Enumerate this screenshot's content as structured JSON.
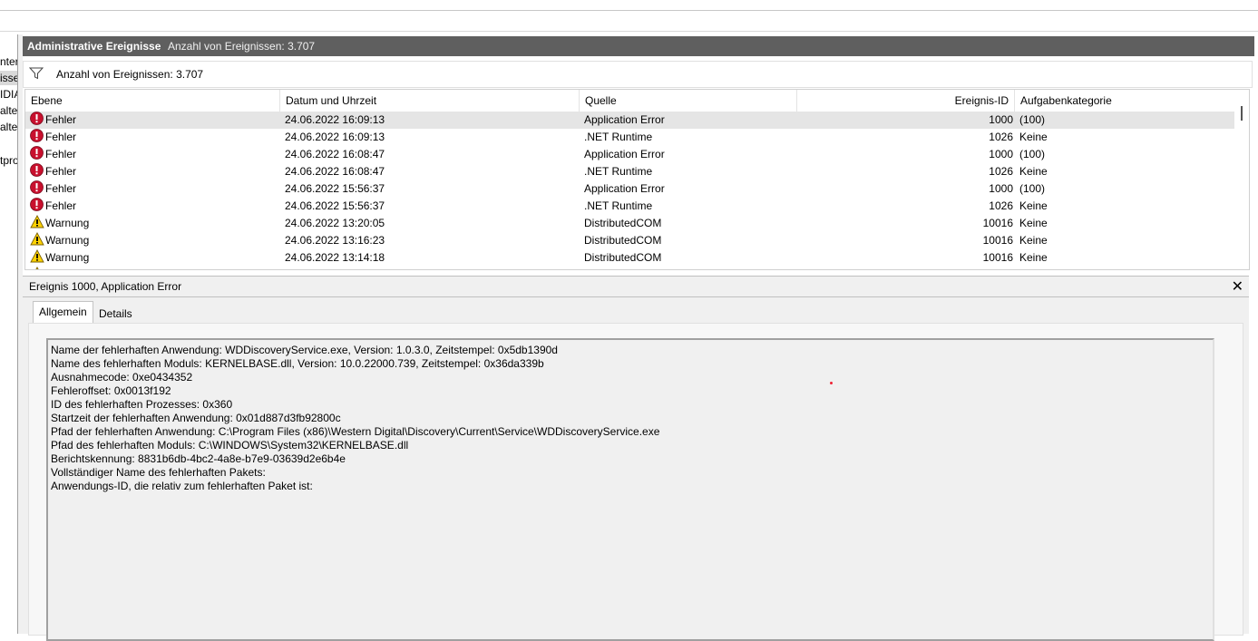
{
  "left_pane": {
    "items": [
      "nter",
      "isse",
      "IDIA",
      "altel",
      "altel",
      "tpro"
    ]
  },
  "header": {
    "title": "Administrative Ereignisse",
    "count": "Anzahl von Ereignissen: 3.707"
  },
  "filter": {
    "text": "Anzahl von Ereignissen: 3.707",
    "icon": "filter-icon"
  },
  "columns": {
    "level": "Ebene",
    "datetime": "Datum und Uhrzeit",
    "source": "Quelle",
    "event_id": "Ereignis-ID",
    "task_category": "Aufgabenkategorie"
  },
  "events": [
    {
      "level": "Fehler",
      "icon": "error-icon",
      "datetime": "24.06.2022 16:09:13",
      "source": "Application Error",
      "event_id": "1000",
      "task": "(100)"
    },
    {
      "level": "Fehler",
      "icon": "error-icon",
      "datetime": "24.06.2022 16:09:13",
      "source": ".NET Runtime",
      "event_id": "1026",
      "task": "Keine"
    },
    {
      "level": "Fehler",
      "icon": "error-icon",
      "datetime": "24.06.2022 16:08:47",
      "source": "Application Error",
      "event_id": "1000",
      "task": "(100)"
    },
    {
      "level": "Fehler",
      "icon": "error-icon",
      "datetime": "24.06.2022 16:08:47",
      "source": ".NET Runtime",
      "event_id": "1026",
      "task": "Keine"
    },
    {
      "level": "Fehler",
      "icon": "error-icon",
      "datetime": "24.06.2022 15:56:37",
      "source": "Application Error",
      "event_id": "1000",
      "task": "(100)"
    },
    {
      "level": "Fehler",
      "icon": "error-icon",
      "datetime": "24.06.2022 15:56:37",
      "source": ".NET Runtime",
      "event_id": "1026",
      "task": "Keine"
    },
    {
      "level": "Warnung",
      "icon": "warning-icon",
      "datetime": "24.06.2022 13:20:05",
      "source": "DistributedCOM",
      "event_id": "10016",
      "task": "Keine"
    },
    {
      "level": "Warnung",
      "icon": "warning-icon",
      "datetime": "24.06.2022 13:16:23",
      "source": "DistributedCOM",
      "event_id": "10016",
      "task": "Keine"
    },
    {
      "level": "Warnung",
      "icon": "warning-icon",
      "datetime": "24.06.2022 13:14:18",
      "source": "DistributedCOM",
      "event_id": "10016",
      "task": "Keine"
    }
  ],
  "detail": {
    "title": "Ereignis 1000, Application Error",
    "close": "✕",
    "tabs": [
      "Allgemein",
      "Details"
    ],
    "lines": [
      "Name der fehlerhaften Anwendung: WDDiscoveryService.exe, Version: 1.0.3.0, Zeitstempel: 0x5db1390d",
      "Name des fehlerhaften Moduls: KERNELBASE.dll, Version: 10.0.22000.739, Zeitstempel: 0x36da339b",
      "Ausnahmecode: 0xe0434352",
      "Fehleroffset: 0x0013f192",
      "ID des fehlerhaften Prozesses: 0x360",
      "Startzeit der fehlerhaften Anwendung: 0x01d887d3fb92800c",
      "Pfad der fehlerhaften Anwendung: C:\\Program Files (x86)\\Western Digital\\Discovery\\Current\\Service\\WDDiscoveryService.exe",
      "Pfad des fehlerhaften Moduls: C:\\WINDOWS\\System32\\KERNELBASE.dll",
      "Berichtskennung: 8831b6db-4bc2-4a8e-b7e9-03639d2e6b4e",
      "Vollständiger Name des fehlerhaften Pakets:",
      "Anwendungs-ID, die relativ zum fehlerhaften Paket ist:"
    ]
  },
  "colors": {
    "header_bg": "#5f5f5f",
    "error_red": "#c8102e",
    "warning_yellow": "#ffd200"
  }
}
